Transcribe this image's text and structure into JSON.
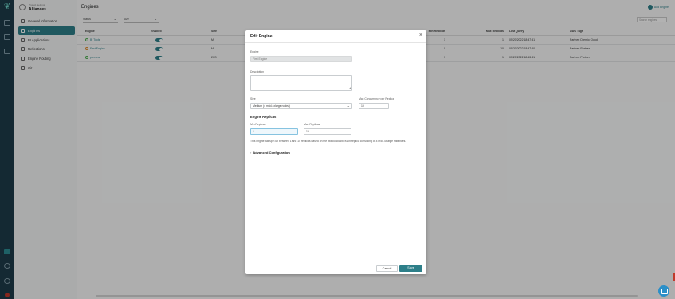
{
  "project": {
    "label": "Project Settings",
    "name": "Alliances"
  },
  "sidebar": {
    "items": [
      {
        "label": "General Information",
        "icon": "info-icon"
      },
      {
        "label": "Engines",
        "icon": "engine-icon",
        "active": true
      },
      {
        "label": "BI Applications",
        "icon": "bi-icon"
      },
      {
        "label": "Reflections",
        "icon": "reflection-icon"
      },
      {
        "label": "Engine Routing",
        "icon": "routing-icon"
      },
      {
        "label": "Git",
        "icon": "git-icon"
      }
    ]
  },
  "page": {
    "title": "Engines",
    "add_label": "Add Engine",
    "filters": [
      "Status",
      "Size"
    ],
    "search_placeholder": "Search engines"
  },
  "table": {
    "headers": {
      "engine": "Engine",
      "enabled": "Enabled",
      "size": "Size",
      "replicas": "Min Replicas",
      "max_replicas": "Max Replicas",
      "last_query": "Last Query",
      "tags": "AWS Tags"
    },
    "rows": [
      {
        "engine": "BI Tools",
        "status": "running",
        "size": "M",
        "replicas": "1",
        "max_replicas": "1",
        "last_query": "05/20/2022 18:47:51",
        "tags": "Partner: Dremio Cloud"
      },
      {
        "engine": "First Engine",
        "status": "stopped",
        "size": "M",
        "replicas": "0",
        "max_replicas": "10",
        "last_query": "05/20/2022 18:47:40",
        "tags": "Partner: Partner"
      },
      {
        "engine": "preview",
        "status": "running",
        "size": "2XS",
        "replicas": "1",
        "max_replicas": "1",
        "last_query": "05/20/2022 18:43:31",
        "tags": "Partner: Partner"
      }
    ]
  },
  "modal": {
    "title": "Edit Engine",
    "engine_label": "Engine",
    "engine_value": "First Engine",
    "description_label": "Description",
    "size_label": "Size",
    "size_value": "Medium (4 m5d.4xlarge nodes)",
    "concurrency_label": "Max Concurrency per Replica",
    "concurrency_value": "10",
    "replicas_section": "Engine Replicas",
    "min_label": "Min Replicas",
    "min_value": "1",
    "max_label": "Max Replicas",
    "max_value": "10",
    "info_text": "This engine will spin up between 1 and 10 replicas based on the workload with each replica consisting of 4 m5d.4xlarge instances.",
    "advanced_label": "Advanced Configuration",
    "cancel_label": "Cancel",
    "save_label": "Save"
  },
  "colors": {
    "accent": "#2d7f89",
    "rail": "#1e3b49"
  }
}
